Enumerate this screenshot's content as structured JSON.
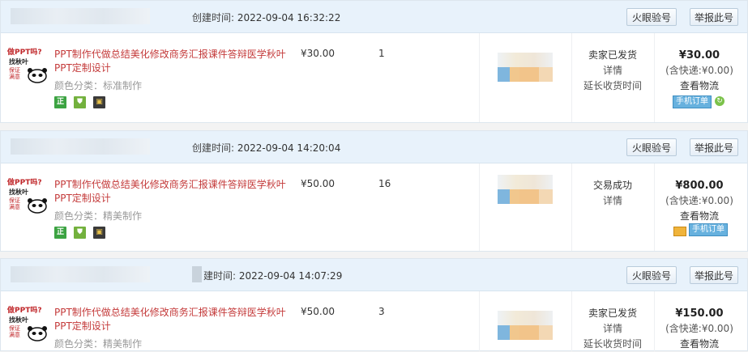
{
  "orders": [
    {
      "created_label": "创建时间:",
      "created_time": "2022-09-04 16:32:22",
      "btn_fire": "火眼验号",
      "btn_report": "举报此号",
      "thumb_line1": "做PPT吗?",
      "thumb_line2": "找秋叶",
      "thumb_line3": "保证满意",
      "title": "PPT制作代做总结美化修改商务汇报课件答辩医学秋叶PPT定制设计",
      "sku": "颜色分类：标准制作",
      "price": "¥30.00",
      "qty": "1",
      "status_lines": [
        "卖家已发货",
        "详情",
        "延长收货时间"
      ],
      "total": "¥30.00",
      "shipping": "(含快递:¥0.00)",
      "logistics": "查看物流",
      "mobile_tag": "手机订单"
    },
    {
      "created_label": "创建时间:",
      "created_time": "2022-09-04 14:20:04",
      "btn_fire": "火眼验号",
      "btn_report": "举报此号",
      "thumb_line1": "做PPT吗?",
      "thumb_line2": "找秋叶",
      "thumb_line3": "保证满意",
      "title": "PPT制作代做总结美化修改商务汇报课件答辩医学秋叶PPT定制设计",
      "sku": "颜色分类：精美制作",
      "price": "¥50.00",
      "qty": "16",
      "status_lines": [
        "交易成功",
        "详情"
      ],
      "total": "¥800.00",
      "shipping": "(含快递:¥0.00)",
      "logistics": "查看物流",
      "mobile_tag": "手机订单"
    },
    {
      "created_label": "建时间:",
      "created_time": "2022-09-04 14:07:29",
      "btn_fire": "火眼验号",
      "btn_report": "举报此号",
      "thumb_line1": "做PPT吗?",
      "thumb_line2": "找秋叶",
      "thumb_line3": "保证满意",
      "title": "PPT制作代做总结美化修改商务汇报课件答辩医学秋叶PPT定制设计",
      "sku": "颜色分类：精美制作",
      "price": "¥50.00",
      "qty": "3",
      "status_lines": [
        "卖家已发货",
        "详情",
        "延长收货时间"
      ],
      "total": "¥150.00",
      "shipping": "(含快递:¥0.00)",
      "logistics": "查看物流"
    }
  ],
  "icons": {
    "zheng": "正",
    "shield": "盾",
    "gift": "礼"
  },
  "colors": {
    "header_bg": "#e8f2fb",
    "title_red": "#c43a3a",
    "mobile_blue": "#67b1de"
  }
}
